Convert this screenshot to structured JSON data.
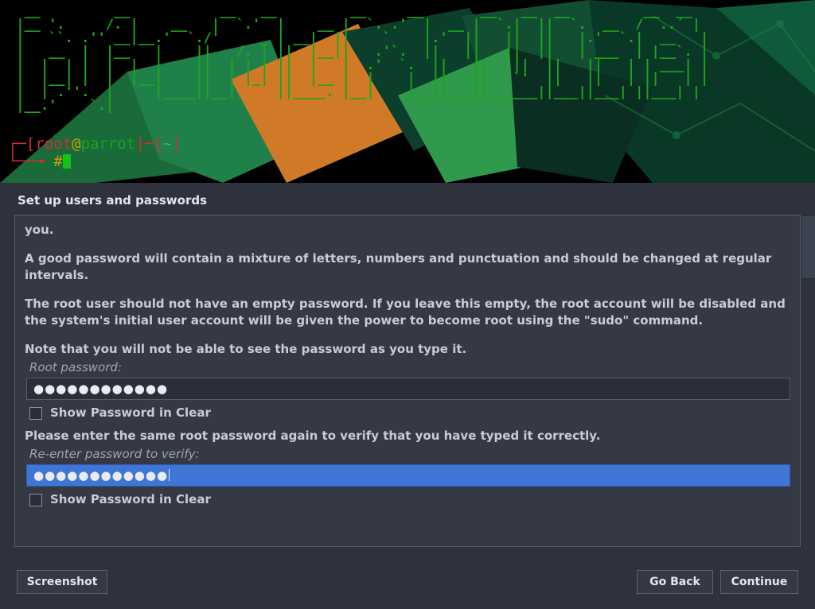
{
  "banner": {
    "ascii": "  __         __           __   __         __     __       __   __  __         __  __   \n |__ '.     /. |    __   |  `.'  |    __ |  `. .'  |  __ |  `.|  ||  `.  __  /  ..´ |  \n |   ``. .'' __|__.'  `./'     _ | __|  ||    `    |.'  ||   ||  ||   |.'  `.|  __   |  \n |   __  |  |__   |    ||   /. | ||  |__||   .'`.  ||   ||   ||  ||   | ___  | |__`. |  \n |  |  | |  |  |  |    ||  | | | ||  |   |  .'  `.  ||   ||   ||  ||   ||   | | ___| |  \n |  |__| |  |  |__|    ||  | |_| ||  |__ |  |    |  ||   ||   `'  ||   ||   | ||   | |  \n |  | .''.  |     |____||__|     ||____. |__|    |__||___||______||___||___| ||___| |  \n |__.'    `.|                                                                          ",
    "prompt_user": "root",
    "prompt_at": "@",
    "prompt_host": "parrot",
    "prompt_path": "~",
    "hash": "#"
  },
  "title": "Set up users and passwords",
  "body": {
    "p0": "you.",
    "p1": "A good password will contain a mixture of letters, numbers and punctuation and should be changed at regular intervals.",
    "p2": "The root user should not have an empty password. If you leave this empty, the root account will be disabled and the system's initial user account will be given the power to become root using the \"sudo\" command.",
    "p3": "Note that you will not be able to see the password as you type it.",
    "label_root": "Root password:",
    "dots1": "●●●●●●●●●●●●",
    "show1": "Show Password in Clear",
    "p4": "Please enter the same root password again to verify that you have typed it correctly.",
    "label_verify": "Re-enter password to verify:",
    "dots2": "●●●●●●●●●●●●",
    "show2": "Show Password in Clear"
  },
  "buttons": {
    "screenshot": "Screenshot",
    "goback": "Go Back",
    "continue": "Continue"
  }
}
